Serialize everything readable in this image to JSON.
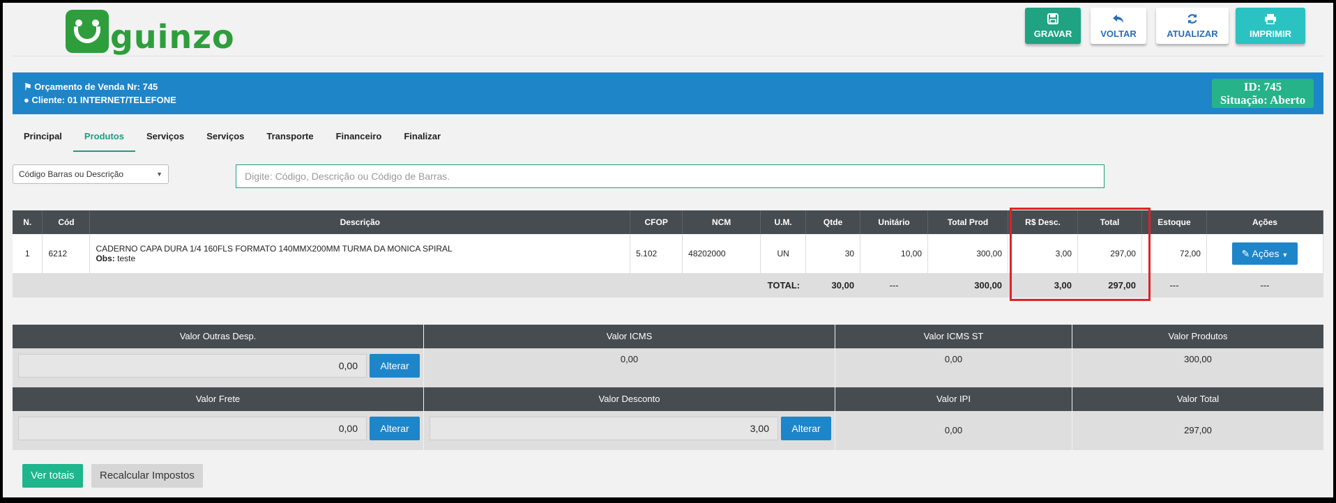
{
  "brand": {
    "name": "guinzo"
  },
  "toolbar": {
    "gravar": "GRAVAR",
    "voltar": "VOLTAR",
    "atualizar": "ATUALIZAR",
    "imprimir": "IMPRIMIR"
  },
  "banner": {
    "orcamento": "Orçamento de Venda Nr: 745",
    "cliente": "Cliente: 01 INTERNET/TELEFONE",
    "id": "ID: 745",
    "situacao": "Situação: Aberto"
  },
  "tabs": [
    "Principal",
    "Produtos",
    "Serviços",
    "Serviços",
    "Transporte",
    "Financeiro",
    "Finalizar"
  ],
  "search": {
    "mode": "Código Barras ou Descrição",
    "placeholder": "Digite: Código, Descrição ou Código de Barras."
  },
  "products": {
    "headers": [
      "N.",
      "Cód",
      "Descrição",
      "CFOP",
      "NCM",
      "U.M.",
      "Qtde",
      "Unitário",
      "Total Prod",
      "R$ Desc.",
      "Total",
      "Estoque",
      "Ações"
    ],
    "row": {
      "n": "1",
      "cod": "6212",
      "descricao": "CADERNO CAPA DURA 1/4 160FLS FORMATO 140MMX200MM TURMA DA MONICA SPIRAL",
      "obs_label": "Obs:",
      "obs": "teste",
      "cfop": "5.102",
      "ncm": "48202000",
      "um": "UN",
      "qtde": "30",
      "unitario": "10,00",
      "total_prod": "300,00",
      "desc": "3,00",
      "total": "297,00",
      "estoque": "72,00",
      "acoes": "Ações"
    },
    "totals": {
      "label": "TOTAL:",
      "qtde": "30,00",
      "unitario": "---",
      "total_prod": "300,00",
      "desc": "3,00",
      "total": "297,00",
      "estoque": "---",
      "acoes": "---"
    }
  },
  "summary": {
    "outras_desp": {
      "label": "Valor Outras Desp.",
      "value": "0,00",
      "button": "Alterar"
    },
    "icms": {
      "label": "Valor ICMS",
      "value": "0,00"
    },
    "icms_st": {
      "label": "Valor ICMS ST",
      "value": "0,00"
    },
    "produtos": {
      "label": "Valor Produtos",
      "value": "300,00"
    },
    "frete": {
      "label": "Valor Frete",
      "value": "0,00",
      "button": "Alterar"
    },
    "desconto": {
      "label": "Valor Desconto",
      "value": "3,00",
      "button": "Alterar"
    },
    "ipi": {
      "label": "Valor IPI",
      "value": "0,00"
    },
    "total": {
      "label": "Valor Total",
      "value": "297,00"
    }
  },
  "footer": {
    "ver_totais": "Ver totais",
    "recalcular": "Recalcular Impostos"
  },
  "colors": {
    "accent": "#1a9e82",
    "blue": "#1e85c9",
    "header_dark": "#474c51",
    "highlight": "#e02128"
  }
}
